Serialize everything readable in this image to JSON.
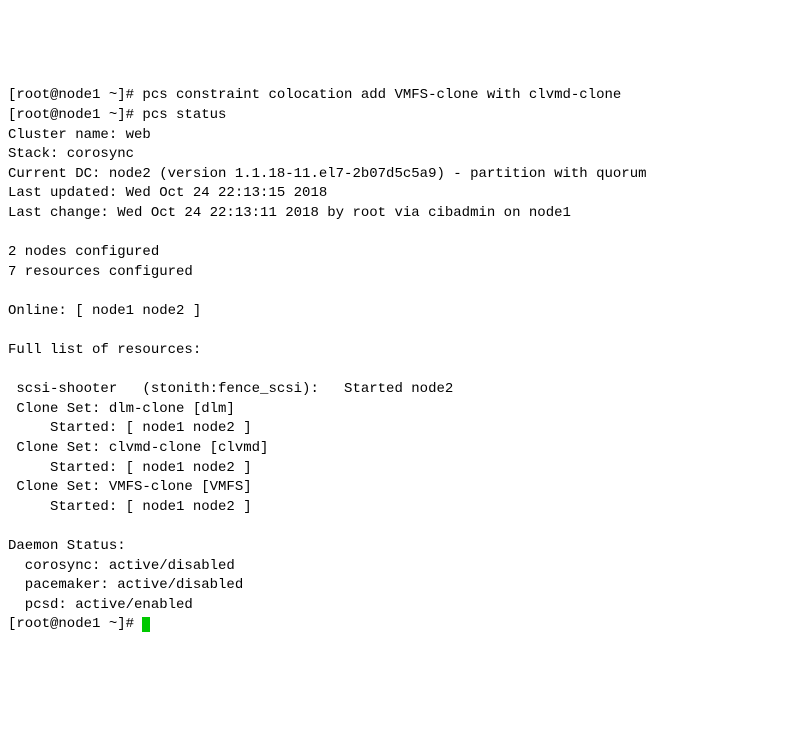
{
  "lines": {
    "l1": "[root@node1 ~]# pcs constraint colocation add VMFS-clone with clvmd-clone",
    "l2": "[root@node1 ~]# pcs status",
    "l3": "Cluster name: web",
    "l4": "Stack: corosync",
    "l5": "Current DC: node2 (version 1.1.18-11.el7-2b07d5c5a9) - partition with quorum",
    "l6": "Last updated: Wed Oct 24 22:13:15 2018",
    "l7": "Last change: Wed Oct 24 22:13:11 2018 by root via cibadmin on node1",
    "l8": "",
    "l9": "2 nodes configured",
    "l10": "7 resources configured",
    "l11": "",
    "l12": "Online: [ node1 node2 ]",
    "l13": "",
    "l14": "Full list of resources:",
    "l15": "",
    "l16": " scsi-shooter   (stonith:fence_scsi):   Started node2",
    "l17": " Clone Set: dlm-clone [dlm]",
    "l18": "     Started: [ node1 node2 ]",
    "l19": " Clone Set: clvmd-clone [clvmd]",
    "l20": "     Started: [ node1 node2 ]",
    "l21": " Clone Set: VMFS-clone [VMFS]",
    "l22": "     Started: [ node1 node2 ]",
    "l23": "",
    "l24": "Daemon Status:",
    "l25": "  corosync: active/disabled",
    "l26": "  pacemaker: active/disabled",
    "l27": "  pcsd: active/enabled",
    "l28": "[root@node1 ~]# "
  }
}
